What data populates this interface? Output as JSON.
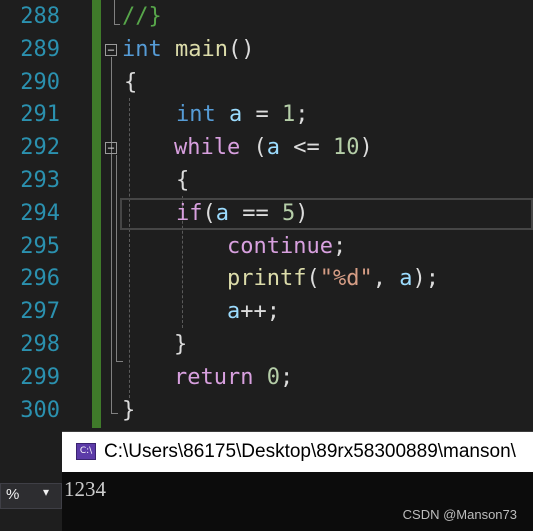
{
  "editor": {
    "line_numbers": [
      "288",
      "289",
      "290",
      "291",
      "292",
      "293",
      "294",
      "295",
      "296",
      "297",
      "298",
      "299",
      "300"
    ],
    "lines": [
      [
        {
          "t": "//}",
          "c": "cmt"
        }
      ],
      [
        {
          "t": "int",
          "c": "kw"
        },
        {
          "t": " ",
          "c": ""
        },
        {
          "t": "main",
          "c": "fn"
        },
        {
          "t": "()",
          "c": ""
        }
      ],
      [
        {
          "t": "{",
          "c": ""
        }
      ],
      [
        {
          "t": "int",
          "c": "kw"
        },
        {
          "t": " ",
          "c": ""
        },
        {
          "t": "a",
          "c": "var"
        },
        {
          "t": " = ",
          "c": ""
        },
        {
          "t": "1",
          "c": "num"
        },
        {
          "t": ";",
          "c": ""
        }
      ],
      [
        {
          "t": "while",
          "c": "ctl"
        },
        {
          "t": " (",
          "c": ""
        },
        {
          "t": "a",
          "c": "var"
        },
        {
          "t": " <= ",
          "c": ""
        },
        {
          "t": "10",
          "c": "num"
        },
        {
          "t": ")",
          "c": ""
        }
      ],
      [
        {
          "t": "{",
          "c": ""
        }
      ],
      [
        {
          "t": "if",
          "c": "ctl"
        },
        {
          "t": "(",
          "c": ""
        },
        {
          "t": "a",
          "c": "var"
        },
        {
          "t": " == ",
          "c": ""
        },
        {
          "t": "5",
          "c": "num"
        },
        {
          "t": ")",
          "c": ""
        }
      ],
      [
        {
          "t": "continue",
          "c": "ctl"
        },
        {
          "t": ";",
          "c": ""
        }
      ],
      [
        {
          "t": "printf",
          "c": "fn"
        },
        {
          "t": "(",
          "c": ""
        },
        {
          "t": "\"%d\"",
          "c": "str"
        },
        {
          "t": ", ",
          "c": ""
        },
        {
          "t": "a",
          "c": "var"
        },
        {
          "t": ");",
          "c": ""
        }
      ],
      [
        {
          "t": "a",
          "c": "var"
        },
        {
          "t": "++;",
          "c": ""
        }
      ],
      [
        {
          "t": "}",
          "c": ""
        }
      ],
      [
        {
          "t": "return",
          "c": "ctl"
        },
        {
          "t": " ",
          "c": ""
        },
        {
          "t": "0",
          "c": "num"
        },
        {
          "t": ";",
          "c": ""
        }
      ],
      [
        {
          "t": "}",
          "c": ""
        }
      ]
    ],
    "fold_glyph": "−"
  },
  "console": {
    "icon_text": "C:\\",
    "title": "C:\\Users\\86175\\Desktop\\89rx58300889\\manson\\",
    "output": "1234"
  },
  "zoom": {
    "value": "%",
    "arrow": "▾"
  },
  "watermark": "CSDN @Manson73"
}
